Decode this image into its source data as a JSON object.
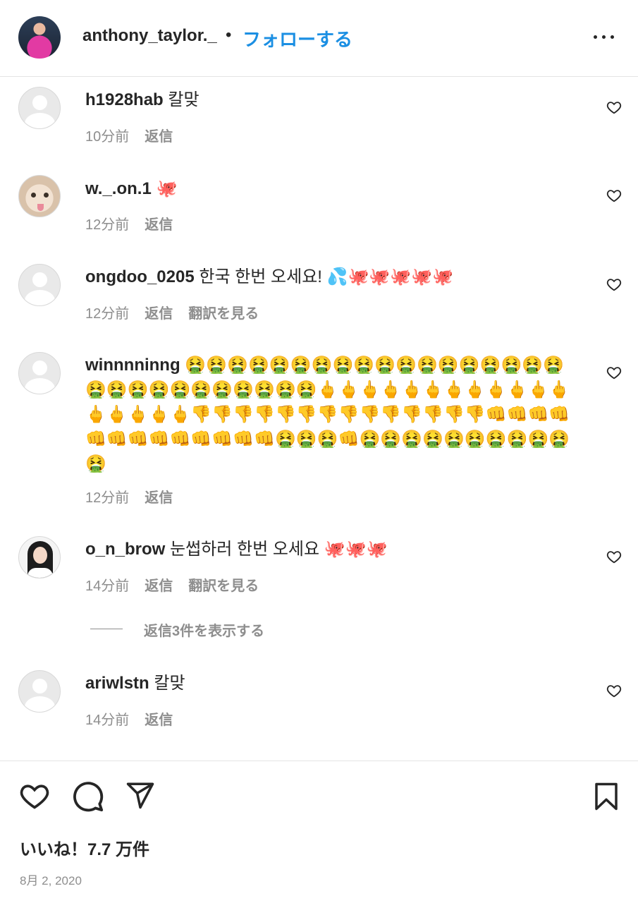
{
  "header": {
    "username": "anthony_taylor._",
    "separator": "•",
    "follow_label": "フォローする"
  },
  "comments": [
    {
      "username": "h1928hab",
      "text": "칼맞",
      "time": "10分前",
      "reply": "返信",
      "avatar": "default-avatar"
    },
    {
      "username": "w._.on.1",
      "text": "🐙",
      "time": "12分前",
      "reply": "返信",
      "avatar": "cat-avatar"
    },
    {
      "username": "ongdoo_0205",
      "text": "한국 한번 오세요! 💦🐙🐙🐙🐙🐙",
      "time": "12分前",
      "reply": "返信",
      "translate": "翻訳を見る",
      "avatar": "default-avatar"
    },
    {
      "username": "winnnninng",
      "text": "🤮🤮🤮🤮🤮🤮🤮🤮🤮🤮🤮🤮🤮🤮🤮🤮🤮🤮🤮🤮🤮🤮🤮🤮🤮🤮🤮🤮🤮🖕🖕🖕🖕🖕🖕🖕🖕🖕🖕🖕🖕🖕🖕🖕🖕🖕👎👎👎👎👎👎👎👎👎👎👎👎👎👎👊👊👊👊👊👊👊👊👊👊👊👊👊🤮🤮🤮👊🤮🤮🤮🤮🤮🤮🤮🤮🤮🤮🤮",
      "time": "12分前",
      "reply": "返信",
      "avatar": "default-avatar"
    },
    {
      "username": "o_n_brow",
      "text": "눈썹하러 한번 오세요 🐙🐙🐙",
      "time": "14分前",
      "reply": "返信",
      "translate": "翻訳を見る",
      "avatar": "girl-avatar"
    },
    {
      "username": "ariwlstn",
      "text": "칼맞",
      "time": "14分前",
      "reply": "返信",
      "avatar": "default-avatar"
    }
  ],
  "view_replies_label": "返信3件を表示する",
  "actions": {
    "like_icon": "heart-icon",
    "comment_icon": "comment-icon",
    "share_icon": "send-icon",
    "save_icon": "bookmark-icon"
  },
  "likes": "いいね！7.7 万件",
  "date": "8月 2, 2020"
}
